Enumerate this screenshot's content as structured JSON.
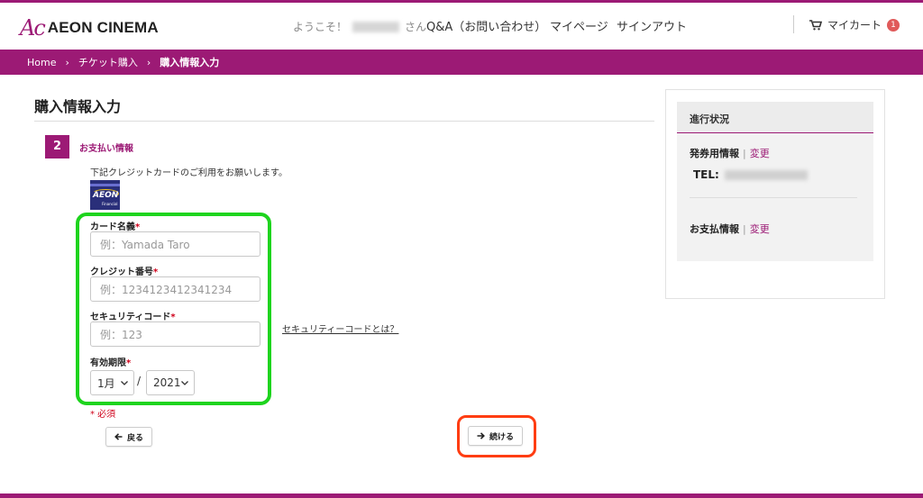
{
  "brand": {
    "logo_mark": "Ac",
    "name": "AEON CINEMA",
    "color": "#9c1a75"
  },
  "header": {
    "welcome_prefix": "ようこそ！",
    "welcome_suffix": "さん",
    "nav_qa": "Q&A（お問い合わせ）",
    "nav_mypage": "マイページ",
    "nav_signout": "サインアウト",
    "cart_label": "マイカート",
    "cart_count": "1"
  },
  "breadcrumb": {
    "home": "Home",
    "ticket": "チケット購入",
    "current": "購入情報入力"
  },
  "page": {
    "title": "購入情報入力"
  },
  "step": {
    "number": "2",
    "label": "お支払い情報"
  },
  "payment": {
    "description": "下記クレジットカードのご利用をお願いします。",
    "card_logo_text": "AEON",
    "card_logo_sub": "Financial",
    "name_label": "カード名義",
    "name_placeholder": "例：Yamada Taro",
    "number_label": "クレジット番号",
    "number_placeholder": "例：1234123412341234",
    "security_label": "セキュリティコード",
    "security_placeholder": "例：123",
    "security_link": "セキュリティーコードとは？",
    "expiry_label": "有効期限",
    "expiry_month": "1月",
    "expiry_separator": "/",
    "expiry_year": "2021",
    "required_mark": "*",
    "required_note": "* 必須"
  },
  "buttons": {
    "back": "戻る",
    "next": "続ける"
  },
  "sidebar": {
    "title": "進行状況",
    "ticket_info_label": "発券用情報",
    "payment_info_label": "お支払情報",
    "pipe": "|",
    "change_label": "変更",
    "tel_label": "TEL:"
  },
  "annotations": {
    "green_frame_color": "#1ed41e",
    "red_frame_color": "#ff3d12"
  }
}
